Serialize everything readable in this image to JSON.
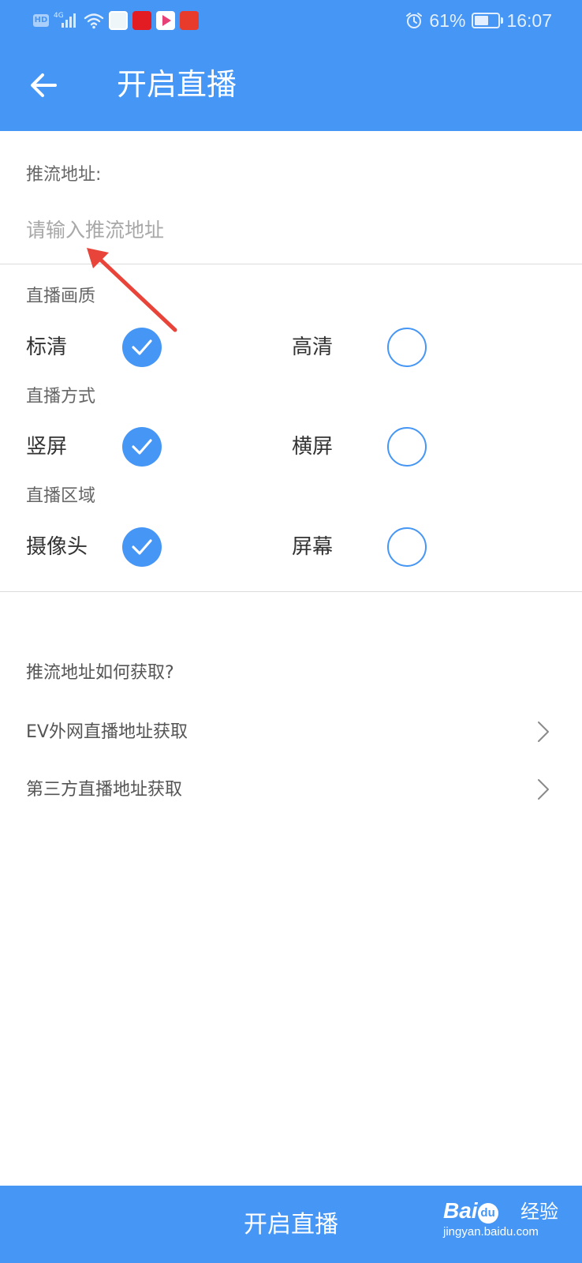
{
  "status_bar": {
    "hd_badge": "HD",
    "network_gen": "4G",
    "battery_text": "61%",
    "battery_level": 0.61,
    "time": "16:07",
    "icons": [
      "hd-badge-icon",
      "signal-icon",
      "wifi-icon",
      "weibo-app-icon",
      "tmall-app-icon",
      "video-app-icon",
      "news-app-icon",
      "alarm-icon",
      "battery-icon"
    ]
  },
  "header": {
    "title": "开启直播",
    "back_icon": "back-arrow-icon"
  },
  "push_url": {
    "label": "推流地址:",
    "value": "",
    "placeholder": "请输入推流地址"
  },
  "options": {
    "quality": {
      "title": "直播画质",
      "items": [
        {
          "label": "标清",
          "checked": true
        },
        {
          "label": "高清",
          "checked": false
        }
      ]
    },
    "orientation": {
      "title": "直播方式",
      "items": [
        {
          "label": "竖屏",
          "checked": true
        },
        {
          "label": "横屏",
          "checked": false
        }
      ]
    },
    "source": {
      "title": "直播区域",
      "items": [
        {
          "label": "摄像头",
          "checked": true
        },
        {
          "label": "屏幕",
          "checked": false
        }
      ]
    }
  },
  "help": {
    "heading": "推流地址如何获取?",
    "links": [
      {
        "label": "EV外网直播地址获取"
      },
      {
        "label": "第三方直播地址获取"
      }
    ]
  },
  "footer": {
    "button_label": "开启直播"
  },
  "watermark": {
    "logo_text": "Bai",
    "logo_circle": "du",
    "logo_cn": "经验",
    "url": "jingyan.baidu.com"
  },
  "colors": {
    "accent": "#4596f5",
    "annotation": "#e8443a",
    "text_primary": "#333333",
    "text_secondary": "#666666",
    "placeholder": "#a8a8a8",
    "divider": "#dcdcdc"
  }
}
